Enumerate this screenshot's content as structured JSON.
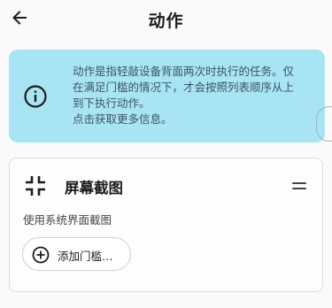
{
  "app_bar": {
    "title": "动作",
    "back_icon": "arrow-left-icon"
  },
  "info_banner": {
    "icon": "info-circle-icon",
    "background": "#a8e4f4",
    "lines": [
      "动作是指轻敲设备背面两次时执行的任务。仅",
      "在满足门槛的情况下，才会按照列表顺序从上",
      "到下执行动作。",
      "点击获取更多信息。"
    ]
  },
  "actions": [
    {
      "icon": "fullscreen-exit-icon",
      "title": "屏幕截图",
      "description": "使用系统界面截图",
      "drag_icon": "drag-handle-icon",
      "add_threshold_label": "添加门槛…",
      "add_icon": "add-circle-icon"
    }
  ]
}
